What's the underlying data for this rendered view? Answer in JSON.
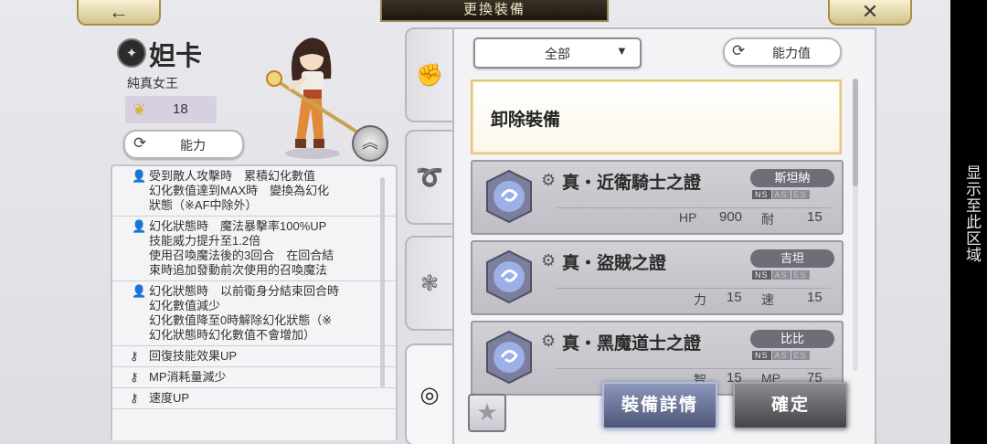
{
  "header": {
    "back_icon": "left-arrow-icon",
    "back_glyph": "←",
    "title": "更換裝備",
    "close_icon": "close-icon",
    "close_glyph": "✕"
  },
  "character": {
    "name": "妲卡",
    "title": "純真女王",
    "level": "18",
    "ability_label": "能力",
    "ability_icon_glyph": "⟳"
  },
  "skills": [
    {
      "icon": "person-icon",
      "text": "受到敵人攻擊時　累積幻化數值\n幻化數值達到MAX時　變換為幻化\n狀態（※AF中除外）"
    },
    {
      "icon": "person-icon",
      "text": "幻化狀態時　魔法暴擊率100%UP\n技能威力提升至1.2倍\n使用召喚魔法後的3回合　在回合結\n束時追加發動前次使用的召喚魔法"
    },
    {
      "icon": "person-icon",
      "text": "幻化狀態時　以前衛身分結束回合時\n幻化數值減少\n幻化數值降至0時解除幻化狀態（※\n幻化狀態時幻化數值不會增加）"
    },
    {
      "icon": "key-icon",
      "text": "回復技能效果UP"
    },
    {
      "icon": "key-icon",
      "text": "MP消耗量減少"
    },
    {
      "icon": "key-icon",
      "text": "速度UP"
    }
  ],
  "tabs": [
    {
      "icon": "fist-icon",
      "glyph": "✊"
    },
    {
      "icon": "swirl-icon",
      "glyph": "➰"
    },
    {
      "icon": "emblem-icon",
      "glyph": "❃"
    },
    {
      "icon": "crystal-swirl-icon",
      "glyph": "◎"
    }
  ],
  "equip": {
    "filter_label": "全部",
    "filter_arrow": "▼",
    "sort_label": "能力值",
    "sort_icon_glyph": "⟳",
    "unequip_label": "卸除裝備",
    "items": [
      {
        "name": "真・近衛騎士之證",
        "owner": "斯坦納",
        "stats": [
          {
            "label": "HP",
            "value": "900"
          },
          {
            "label": "耐",
            "value": "15"
          }
        ]
      },
      {
        "name": "真・盜賊之證",
        "owner": "吉坦",
        "stats": [
          {
            "label": "力",
            "value": "15"
          },
          {
            "label": "速",
            "value": "15"
          }
        ]
      },
      {
        "name": "真・黑魔道士之證",
        "owner": "比比",
        "stats": [
          {
            "label": "智",
            "value": "15"
          },
          {
            "label": "MP",
            "value": "75"
          }
        ]
      }
    ],
    "tags": [
      "NS",
      "AS",
      "ES"
    ],
    "star_glyph": "★",
    "detail_label": "裝備詳情",
    "confirm_label": "確定"
  },
  "sidebar_text": "显示至此区域",
  "colors": {
    "gold_border": "#e3c67a",
    "detail_button": "#6b7499",
    "confirm_button": "#5a5a5e",
    "owner_badge": "#6f6e78"
  }
}
